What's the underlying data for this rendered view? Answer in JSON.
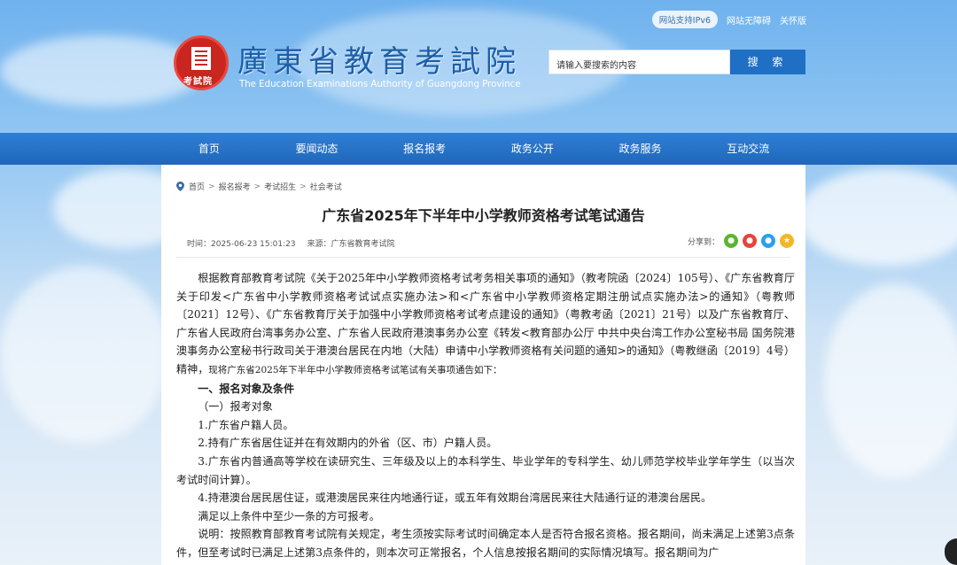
{
  "top_bar": {
    "ipv6_label": "网站支持IPv6",
    "links": [
      "网站无障碍",
      "关怀版"
    ]
  },
  "logo": {
    "emblem_text": "考試院",
    "name_cn": "廣東省教育考試院",
    "name_en": "The Education Examinations Authority of Guangdong Province"
  },
  "search": {
    "placeholder": "请输入要搜索的内容",
    "button_label": "搜 索"
  },
  "nav": {
    "items": [
      "首页",
      "要闻动态",
      "报名报考",
      "政务公开",
      "政务服务",
      "互动交流"
    ]
  },
  "breadcrumb": [
    "首页",
    "报名报考",
    "考试招生",
    "社会考试"
  ],
  "article": {
    "title": "广东省2025年下半年中小学教师资格考试笔试通告",
    "time": "时间：2025-06-23 15:01:23",
    "source": "来源：广东省教育考试院",
    "share_label": "分享到：",
    "share_icons": [
      "wechat-icon",
      "weibo-icon",
      "qq-icon",
      "qzone-icon"
    ],
    "paragraphs": [
      "根据教育部教育考试院《关于2025年中小学教师资格考试考务相关事项的通知》（教考院函〔2024〕105号）、《广东省教育厅关于印发<广东省中小学教师资格考试试点实施办法>和<广东省中小学教师资格定期注册试点实施办法>的通知》（粤教师〔2021〕12号）、《广东省教育厅关于加强中小学教师资格考试考点建设的通知》（粤教考函〔2021〕21号）以及广东省教育厅、广东省人民政府台湾事务办公室、广东省人民政府港澳事务办公室《转发<教育部办公厅 中共中央台湾工作办公室秘书局 国务院港澳事务办公室秘书行政司关于港澳台居民在内地（大陆）申请中小学教师资格有关问题的通知>的通知》（粤教继函〔2019〕4号）精神，",
      "现将广东省2025年下半年中小学教师资格考试笔试有关事项通告如下："
    ],
    "section1": "一、报名对象及条件",
    "subsection1": "（一）报考对象",
    "items": [
      "1.广东省户籍人员。",
      "2.持有广东省居住证并在有效期内的外省（区、市）户籍人员。",
      "3.广东省内普通高等学校在读研究生、三年级及以上的本科学生、毕业学年的专科学生、幼儿师范学校毕业学年学生（以当次考试时间计算）。",
      "4.持港澳台居民居住证，或港澳居民来往内地通行证，或五年有效期台湾居民来往大陆通行证的港澳台居民。",
      "满足以上条件中至少一条的方可报考。",
      "说明：按照教育部教育考试院有关规定，考生须按实际考试时间确定本人是否符合报名资格。报名期间，尚未满足上述第3点条件，但至考试时已满足上述第3点条件的，则本次可正常报名，个人信息按报名期间的实际情况填写。报名期间为广"
    ]
  },
  "colors": {
    "nav_blue": "#1f67bb",
    "search_button": "#1f6fc4",
    "emblem_red": "#c8261f",
    "logo_blue": "#1d5ea8"
  }
}
